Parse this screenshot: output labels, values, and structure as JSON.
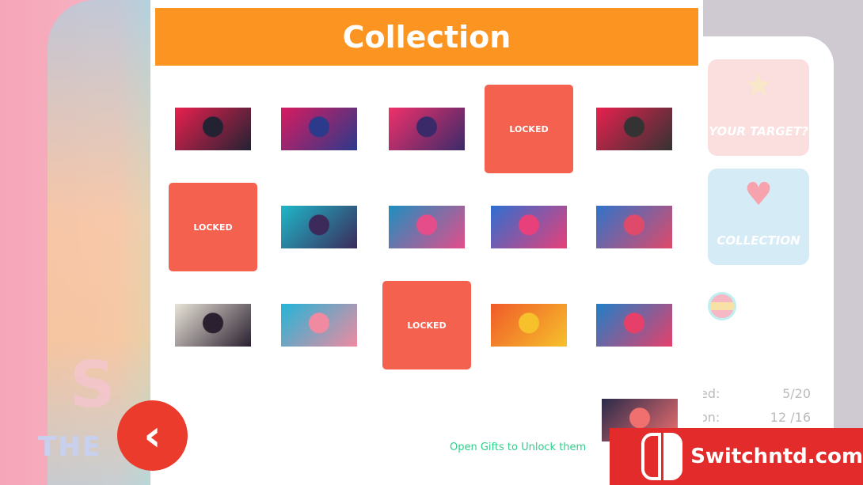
{
  "header": {
    "title": "Collection"
  },
  "locked_label": "LOCKED",
  "hint": "Open Gifts to Unlock them",
  "sidebar": {
    "target_label": "YOUR TARGET?",
    "collection_label": "COLLECTION",
    "stats": [
      {
        "label": "ed:",
        "value": "5/20"
      },
      {
        "label": "on:",
        "value": "12 /16"
      }
    ]
  },
  "watermark": "Switchntd.com",
  "colors": {
    "header": "#fb9420",
    "locked": "#f4614f",
    "back": "#ea3b2c",
    "hint": "#2ecf8a"
  },
  "tiles": [
    {
      "state": "unlocked",
      "colors": [
        "#e8204e",
        "#223"
      ]
    },
    {
      "state": "unlocked",
      "colors": [
        "#d81b60",
        "#2b3a8a"
      ]
    },
    {
      "state": "unlocked",
      "colors": [
        "#f0306a",
        "#3a2a6a"
      ]
    },
    {
      "state": "locked"
    },
    {
      "state": "unlocked",
      "colors": [
        "#e8204e",
        "#333"
      ]
    },
    {
      "state": "locked"
    },
    {
      "state": "unlocked",
      "colors": [
        "#1fb7c9",
        "#3b2a5a"
      ]
    },
    {
      "state": "unlocked",
      "colors": [
        "#1e8fc0",
        "#e44d8a"
      ]
    },
    {
      "state": "unlocked",
      "colors": [
        "#2e6fd0",
        "#e8407a"
      ]
    },
    {
      "state": "unlocked",
      "colors": [
        "#2f74c9",
        "#e04a6a"
      ]
    },
    {
      "state": "unlocked",
      "colors": [
        "#e9e4d8",
        "#2a2030"
      ]
    },
    {
      "state": "unlocked",
      "colors": [
        "#22b5d8",
        "#f08aa0"
      ]
    },
    {
      "state": "locked"
    },
    {
      "state": "unlocked",
      "colors": [
        "#f05a2a",
        "#f6c12b"
      ]
    },
    {
      "state": "unlocked",
      "colors": [
        "#1f7fc8",
        "#e6406a"
      ]
    },
    {
      "state": "unlocked",
      "colors": [
        "#2a2a4a",
        "#f07070"
      ]
    }
  ]
}
